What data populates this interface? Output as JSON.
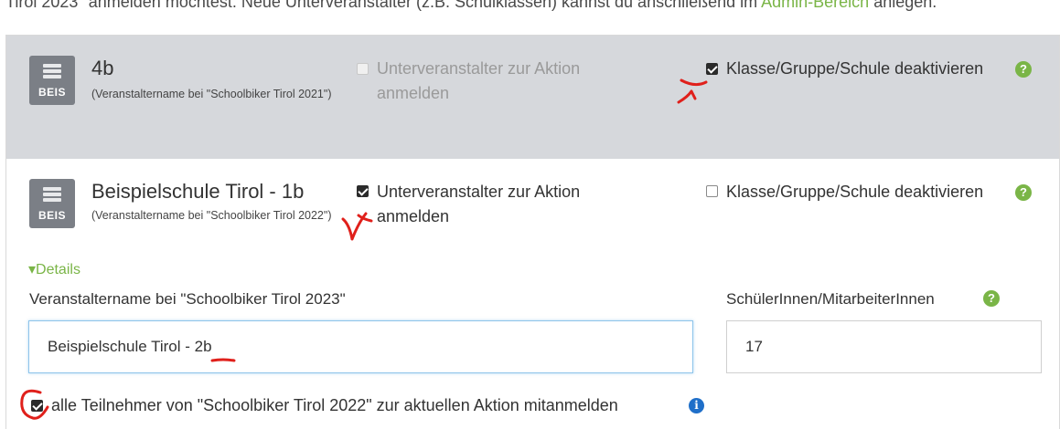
{
  "intro": {
    "text": "Tirol 2023\" anmelden möchtest. Neue Unterveranstalter (z.B. Schulklassen) kannst du anschließend im ",
    "link": "Admin-Bereich",
    "tail": " anlegen."
  },
  "rows": [
    {
      "logo_abbr": "BEIS",
      "name": "4b",
      "subtitle": "(Veranstaltername bei \"Schoolbiker Tirol 2021\")",
      "register_label": "Unterveranstalter zur Aktion anmelden",
      "register_checked": false,
      "register_disabled": true,
      "deactivate_label": "Klasse/Gruppe/Schule deaktivieren",
      "deactivate_checked": true,
      "help_glyph": "?"
    },
    {
      "logo_abbr": "BEIS",
      "name": "Beispielschule Tirol - 1b",
      "subtitle": "(Veranstaltername bei \"Schoolbiker Tirol 2022\")",
      "register_label": "Unterveranstalter zur Aktion anmelden",
      "register_checked": true,
      "register_disabled": false,
      "deactivate_label": "Klasse/Gruppe/Schule deaktivieren",
      "deactivate_checked": false,
      "help_glyph": "?"
    }
  ],
  "details": {
    "toggle_label": "▾Details",
    "name_label": "Veranstaltername bei \"Schoolbiker Tirol 2023\"",
    "name_value": "Beispielschule Tirol - 2b",
    "count_label": "SchülerInnen/MitarbeiterInnen",
    "count_value": "17",
    "help_glyph": "?",
    "carry_over_label": "alle Teilnehmer von \"Schoolbiker Tirol 2022\" zur aktuellen Aktion mitanmelden",
    "carry_over_checked": true,
    "info_glyph": "i"
  },
  "colors": {
    "accent_green": "#7ab547",
    "info_blue": "#1f6fc9",
    "annotation_red": "#e0201b",
    "panel_gray": "#d6d8dc"
  }
}
